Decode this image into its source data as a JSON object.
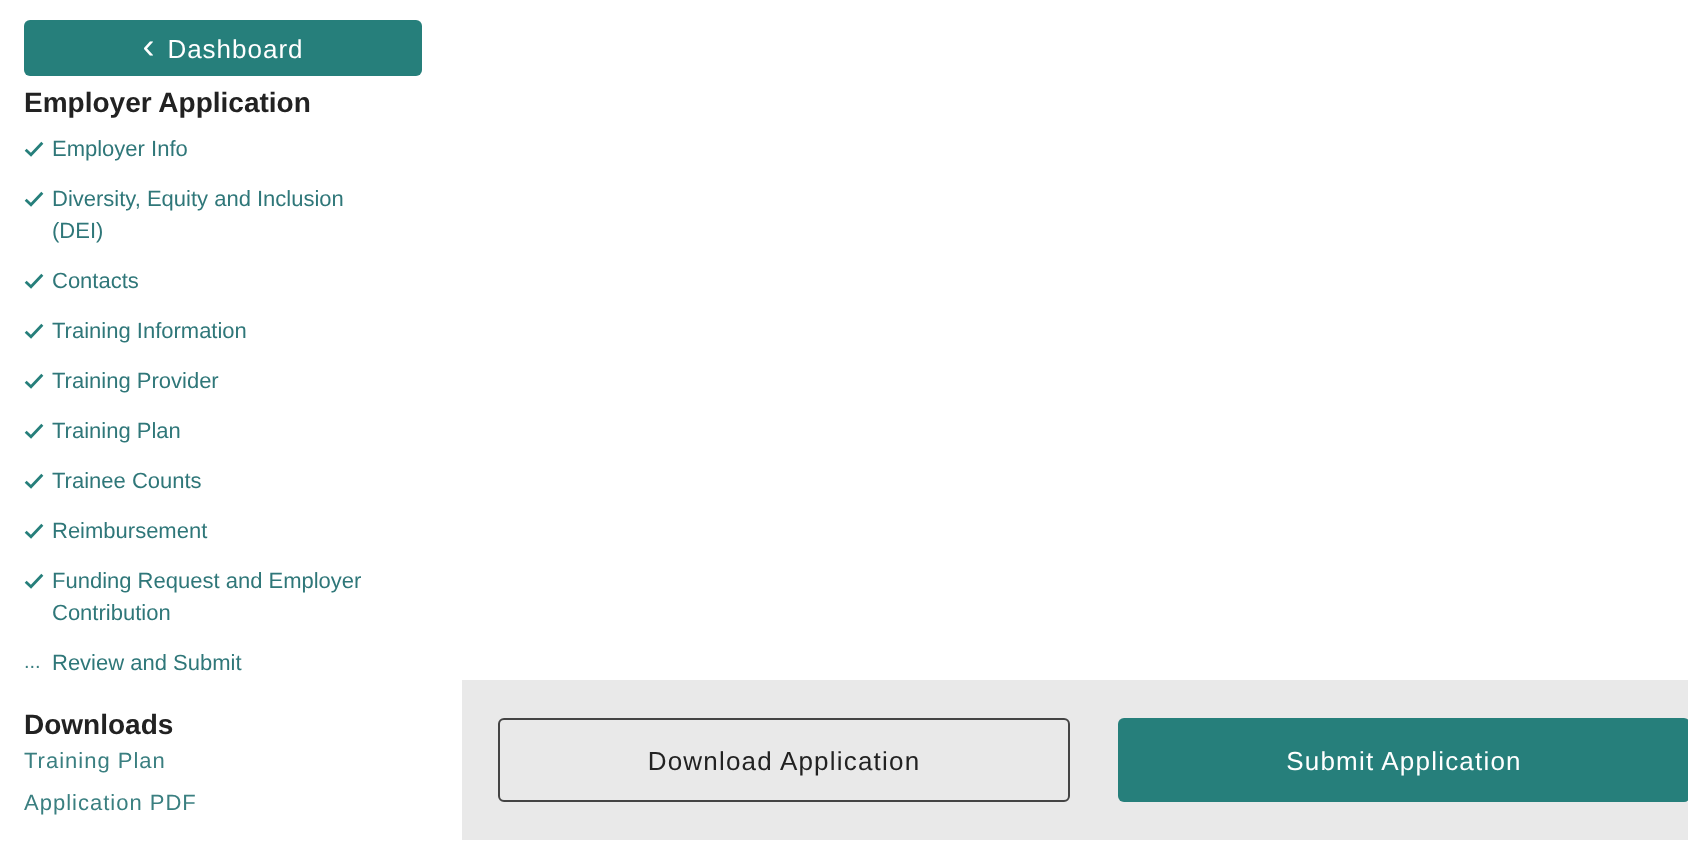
{
  "sidebar": {
    "back_button": {
      "icon": "‹",
      "label": "Dashboard"
    },
    "heading": "Employer Application",
    "steps": [
      {
        "label": "Employer Info",
        "complete": true
      },
      {
        "label": "Diversity, Equity and Inclusion (DEI)",
        "complete": true
      },
      {
        "label": "Contacts",
        "complete": true
      },
      {
        "label": "Training Information",
        "complete": true
      },
      {
        "label": "Training Provider",
        "complete": true
      },
      {
        "label": "Training Plan",
        "complete": true
      },
      {
        "label": "Trainee Counts",
        "complete": true
      },
      {
        "label": "Reimbursement",
        "complete": true
      },
      {
        "label": "Funding Request and Employer Contribution",
        "complete": true
      },
      {
        "label": "Review and Submit",
        "complete": false,
        "marker": "..."
      }
    ],
    "downloads_heading": "Downloads",
    "downloads": [
      "Training Plan",
      "Application PDF"
    ]
  },
  "action_bar": {
    "buttons": [
      {
        "label": "Download Application",
        "kind": "outline"
      },
      {
        "label": "Submit Application",
        "kind": "primary"
      }
    ]
  }
}
